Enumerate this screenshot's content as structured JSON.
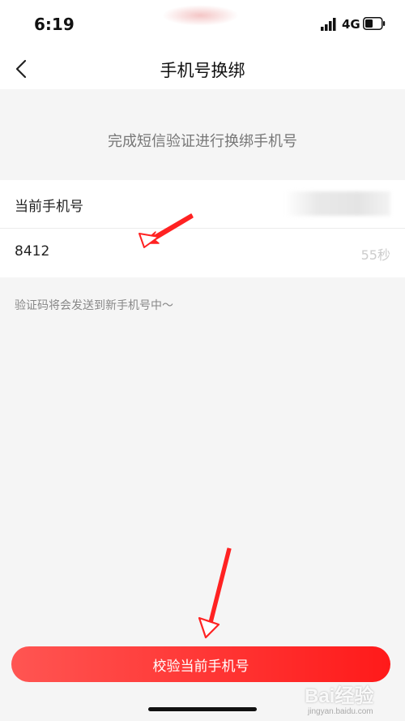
{
  "status_bar": {
    "time": "6:19",
    "network": "4G"
  },
  "nav": {
    "title": "手机号换绑"
  },
  "hint": {
    "text": "完成短信验证进行换绑手机号"
  },
  "form": {
    "current_phone_label": "当前手机号",
    "code_value": "8412",
    "countdown": "55秒"
  },
  "note": {
    "text": "验证码将会发送到新手机号中～"
  },
  "submit": {
    "label": "校验当前手机号"
  },
  "watermark": {
    "main": "Bai经验",
    "sub": "jingyan.baidu.com"
  },
  "colors": {
    "accent": "#ff3333",
    "annotation_arrow": "#ff2222"
  }
}
